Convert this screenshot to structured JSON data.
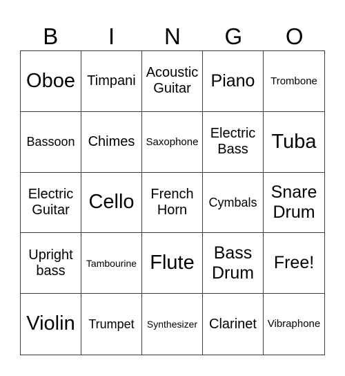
{
  "header": {
    "letters": [
      "B",
      "I",
      "N",
      "G",
      "O"
    ]
  },
  "grid": {
    "rows": [
      [
        "Oboe",
        "Timpani",
        "Acoustic Guitar",
        "Piano",
        "Trombone"
      ],
      [
        "Bassoon",
        "Chimes",
        "Saxophone",
        "Electric Bass",
        "Tuba"
      ],
      [
        "Electric Guitar",
        "Cello",
        "French Horn",
        "Cymbals",
        "Snare Drum"
      ],
      [
        "Upright bass",
        "Tambourine",
        "Flute",
        "Bass Drum",
        "Free!"
      ],
      [
        "Violin",
        "Trumpet",
        "Synthesizer",
        "Clarinet",
        "Vibraphone"
      ]
    ],
    "free_space": "Free!"
  },
  "colors": {
    "grid_line": "#3a3a3a",
    "text": "#000000",
    "background": "#ffffff"
  }
}
